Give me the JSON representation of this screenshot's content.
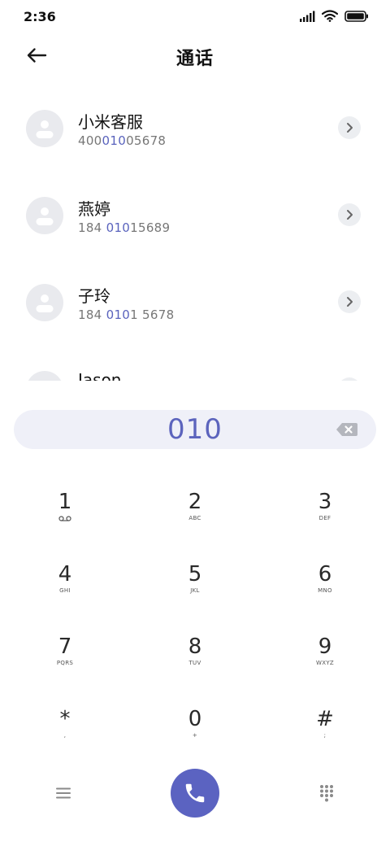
{
  "status_bar": {
    "time": "2:36",
    "icons": [
      "signal-icon",
      "wifi-icon",
      "battery-icon"
    ]
  },
  "header": {
    "title": "通话",
    "back_icon": "arrow-left-icon"
  },
  "contacts": [
    {
      "name": "小米客服",
      "number_pre": "400",
      "number_match": "010",
      "number_post": "05678"
    },
    {
      "name": "燕婷",
      "number_pre": "184 ",
      "number_match": "010",
      "number_post": "15689"
    },
    {
      "name": "子玲",
      "number_pre": "184 ",
      "number_match": "010",
      "number_post": "1 5678"
    },
    {
      "name": "Jason",
      "number_pre": "",
      "number_match": "",
      "number_post": ""
    }
  ],
  "dialer": {
    "number": "010",
    "backspace_icon": "backspace-icon"
  },
  "keypad": [
    {
      "digit": "1",
      "letters": "",
      "sub_icon": "voicemail-icon"
    },
    {
      "digit": "2",
      "letters": "ABC"
    },
    {
      "digit": "3",
      "letters": "DEF"
    },
    {
      "digit": "4",
      "letters": "GHI"
    },
    {
      "digit": "5",
      "letters": "JKL"
    },
    {
      "digit": "6",
      "letters": "MNO"
    },
    {
      "digit": "7",
      "letters": "PQRS"
    },
    {
      "digit": "8",
      "letters": "TUV"
    },
    {
      "digit": "9",
      "letters": "WXYZ"
    },
    {
      "digit": "*",
      "letters": ","
    },
    {
      "digit": "0",
      "letters": "+"
    },
    {
      "digit": "#",
      "letters": ";"
    }
  ],
  "bottom_bar": {
    "menu_icon": "menu-icon",
    "call_icon": "phone-icon",
    "keypad_icon": "dialpad-icon"
  },
  "colors": {
    "accent": "#5b63c1",
    "highlight_text": "#5a63bd",
    "number_bar_bg": "#eff0f8",
    "avatar_bg": "#e9eaee"
  }
}
